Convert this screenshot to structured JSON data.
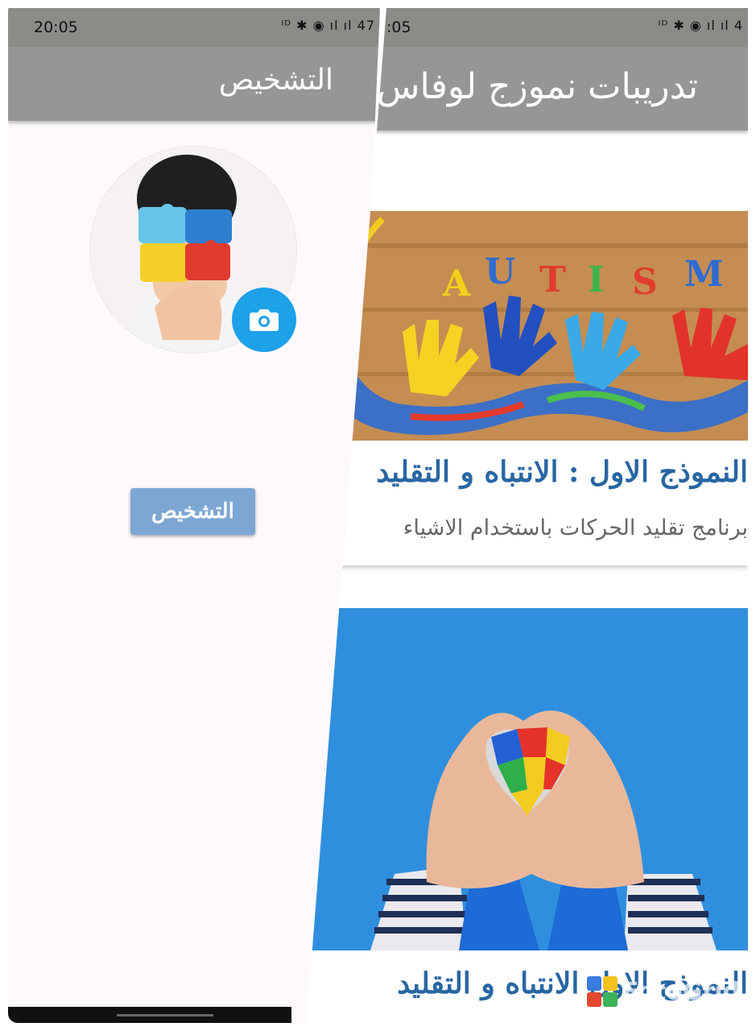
{
  "left_screen": {
    "status_time": "20:05",
    "status_icons": "ᴵᴰ ✱ ◉ ıl ıl 47",
    "app_title": "التشخيص",
    "avatar_alt": "",
    "diagnose_button": "التشخيص"
  },
  "right_screen": {
    "status_time": ":05",
    "status_icons": "ᴵᴰ ✱ ◉ ıl ıl 4",
    "app_title": "تدريبات نموزج لوفاس",
    "cards": [
      {
        "title": "النموذج الاول : الانتباه و التقليد",
        "subtitle": "برنامج تقليد الحركات باستخدام الاشياء",
        "image_text": "AUTISM"
      },
      {
        "title": "النموذج الاول الانتباه و التقليد"
      }
    ]
  },
  "watermark": "FotoGrid",
  "colors": {
    "statusbar": "#8b8b88",
    "appbar": "#969694",
    "camera_button": "#1da1e8",
    "diagnose_button": "#7ea6d4",
    "card_title": "#2866a3"
  }
}
